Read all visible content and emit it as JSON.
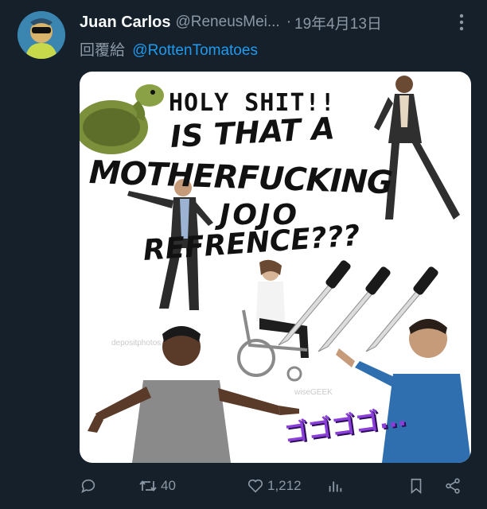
{
  "tweet": {
    "display_name": "Juan Carlos",
    "handle": "@ReneusMei...",
    "date": "19年4月13日",
    "reply_prefix": "回覆給",
    "reply_mention": "@RottenTomatoes"
  },
  "media": {
    "line1": "HOLY SHIT!!",
    "line2": "IS THAT A",
    "line3": "MOTHERFUCKING",
    "line4": "JOJO",
    "line5": "REFRENCE???",
    "menacing": "ゴゴゴゴ...",
    "watermark_site": "wiseGEEK",
    "watermark_stock": "depositphotos"
  },
  "actions": {
    "replies": "",
    "retweets": "40",
    "likes": "1,212"
  },
  "icons": [
    "more-icon",
    "reply-icon",
    "retweet-icon",
    "like-icon",
    "views-icon",
    "bookmark-icon",
    "share-icon"
  ],
  "colors": {
    "background": "#15202b",
    "accent": "#1d9bf0",
    "muted": "#8b98a5"
  }
}
